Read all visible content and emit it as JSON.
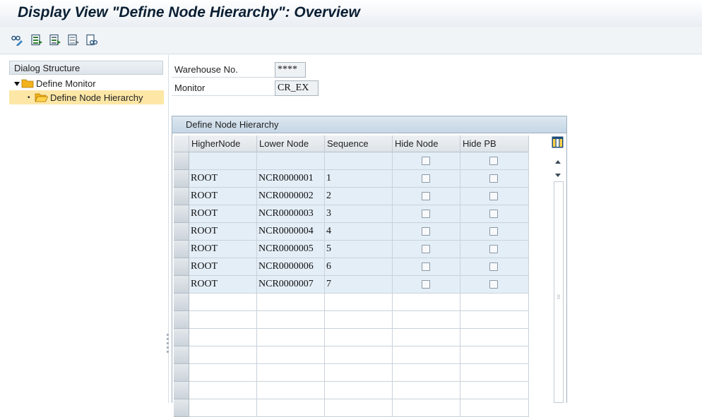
{
  "window": {
    "title": "Display View \"Define Node Hierarchy\": Overview"
  },
  "toolbar": {
    "icons": [
      "glasses-change-icon",
      "select-all-icon",
      "select-block-icon",
      "deselect-all-icon",
      "print-preview-icon"
    ]
  },
  "dialog_structure": {
    "header": "Dialog Structure",
    "items": [
      {
        "label": "Define Monitor",
        "expanded": true,
        "selected": false
      },
      {
        "label": "Define Node Hierarchy",
        "expanded": false,
        "selected": true
      }
    ]
  },
  "form": {
    "warehouse_label": "Warehouse No.",
    "warehouse_value": "****",
    "monitor_label": "Monitor",
    "monitor_value": "CR_EX"
  },
  "table": {
    "caption": "Define Node Hierarchy",
    "columns": [
      "HigherNode",
      "Lower Node",
      "Sequence",
      "Hide Node",
      "Hide PB"
    ],
    "rows": [
      {
        "higher": "",
        "lower": "",
        "seq": "",
        "hide_node": false,
        "hide_pb": false
      },
      {
        "higher": "ROOT",
        "lower": "NCR0000001",
        "seq": "1",
        "hide_node": false,
        "hide_pb": false
      },
      {
        "higher": "ROOT",
        "lower": "NCR0000002",
        "seq": "2",
        "hide_node": false,
        "hide_pb": false
      },
      {
        "higher": "ROOT",
        "lower": "NCR0000003",
        "seq": "3",
        "hide_node": false,
        "hide_pb": false
      },
      {
        "higher": "ROOT",
        "lower": "NCR0000004",
        "seq": "4",
        "hide_node": false,
        "hide_pb": false
      },
      {
        "higher": "ROOT",
        "lower": "NCR0000005",
        "seq": "5",
        "hide_node": false,
        "hide_pb": false
      },
      {
        "higher": "ROOT",
        "lower": "NCR0000006",
        "seq": "6",
        "hide_node": false,
        "hide_pb": false
      },
      {
        "higher": "ROOT",
        "lower": "NCR0000007",
        "seq": "7",
        "hide_node": false,
        "hide_pb": false
      }
    ],
    "empty_rows": 7
  },
  "colors": {
    "row_fill": "#e4eef7",
    "selected_tree": "#fde7a6",
    "folder": "#f2b21c"
  }
}
